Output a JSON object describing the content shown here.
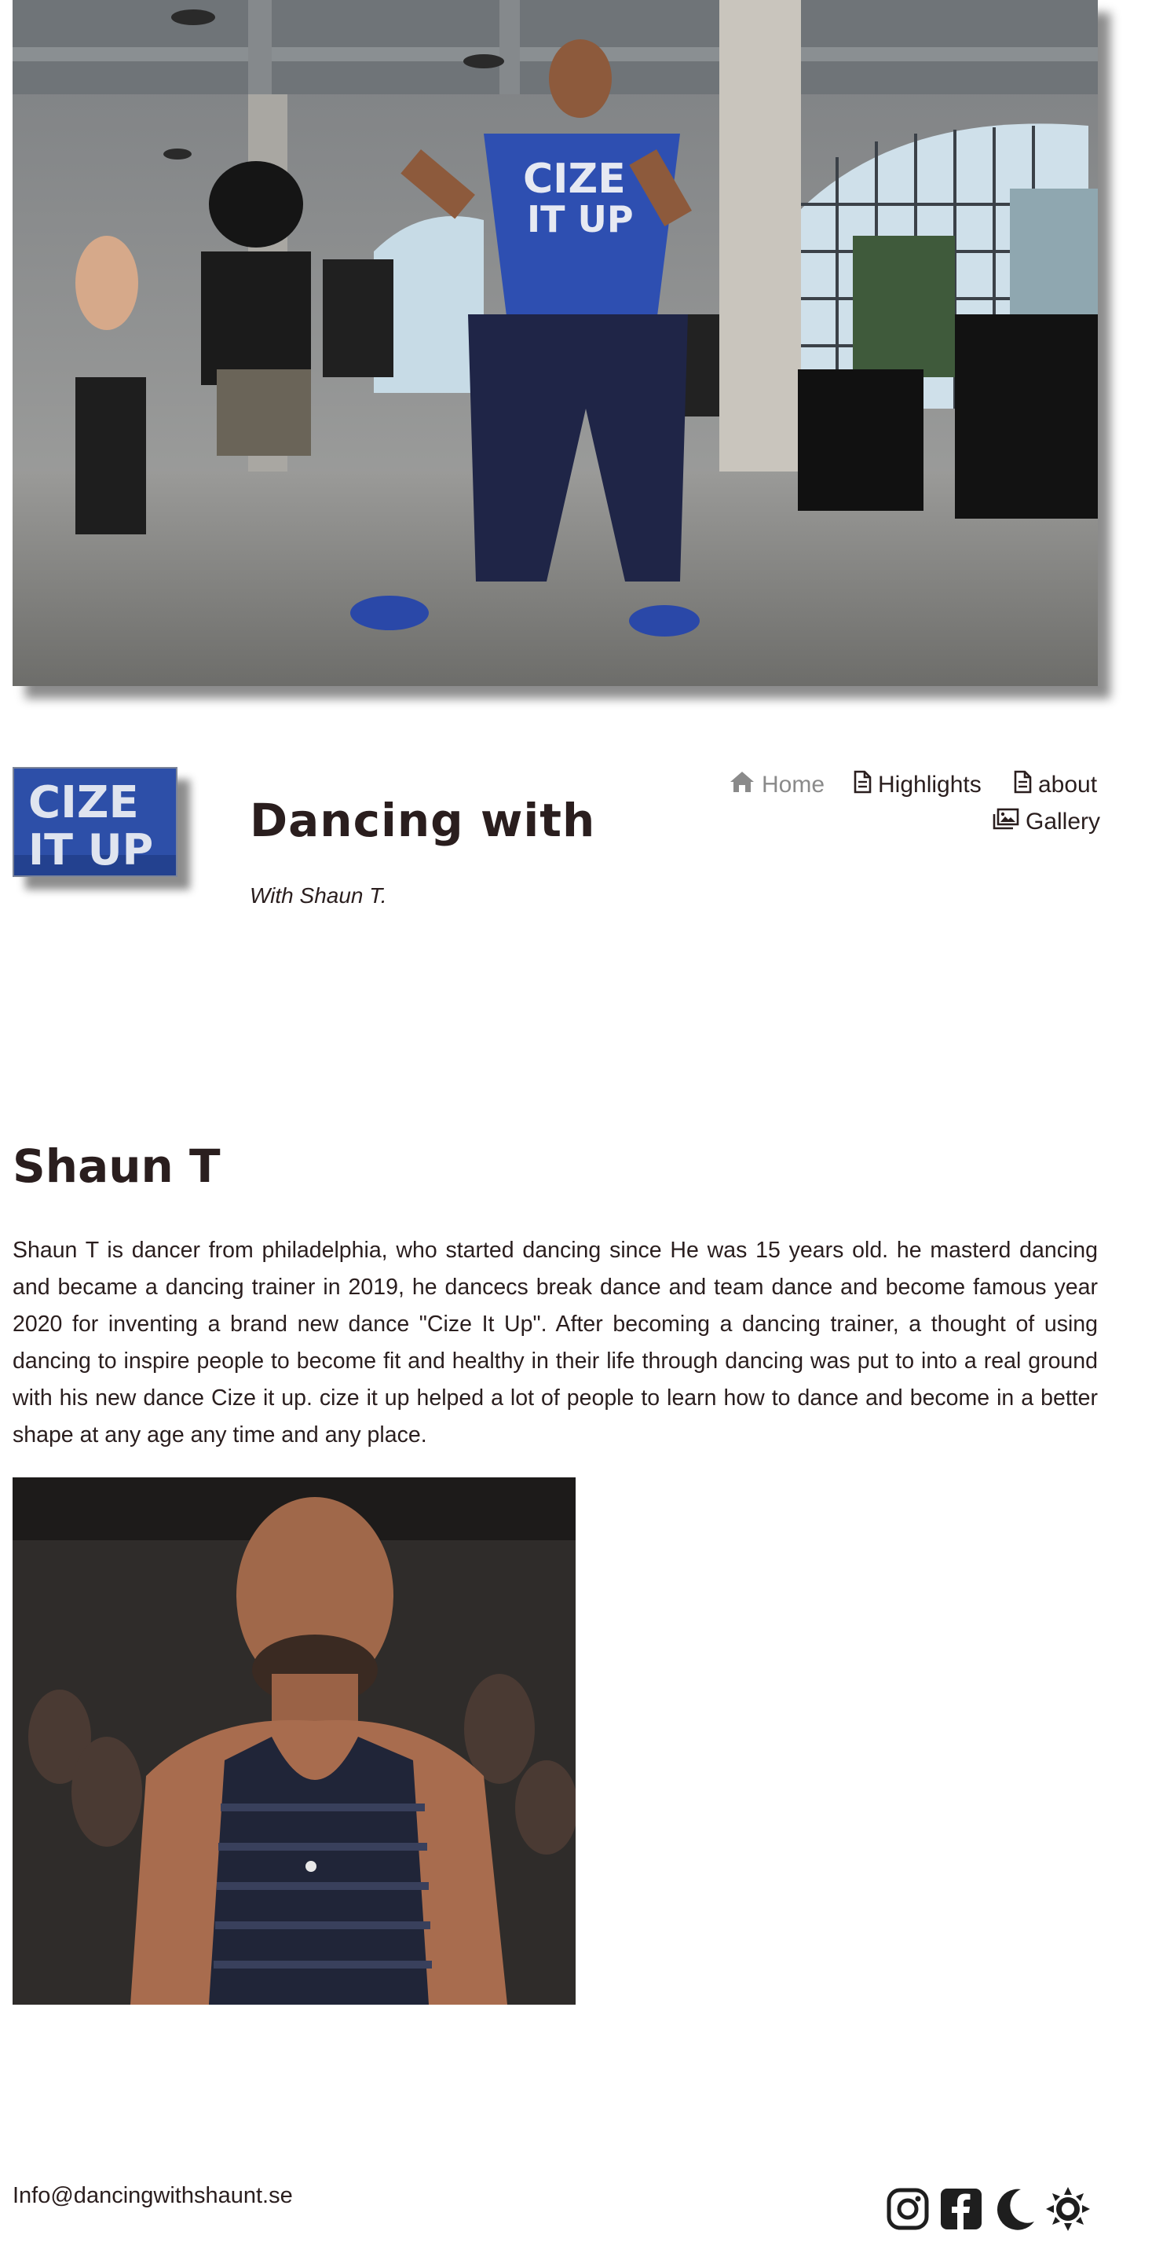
{
  "hero": {
    "icon": "dance-class-photo",
    "shirt_text_line1": "CIZE",
    "shirt_text_line2": "IT UP"
  },
  "header": {
    "logo": {
      "icon": "cize-it-up-logo",
      "text_line1": "CIZE",
      "text_line2": "IT UP"
    },
    "title": "Dancing with",
    "subtitle": "With Shaun T."
  },
  "nav": {
    "items": [
      {
        "label": "Home",
        "icon": "home-icon",
        "active": true
      },
      {
        "label": "Highlights",
        "icon": "document-icon"
      },
      {
        "label": "about",
        "icon": "document-icon"
      },
      {
        "label": "Gallery",
        "icon": "images-icon"
      }
    ]
  },
  "main": {
    "heading": "Shaun T",
    "bio": "Shaun T is dancer from philadelphia, who started dancing since He was 15 years old. he masterd dancing and became a dancing trainer in 2019, he dancecs break dance and team dance and become famous year 2020 for inventing a brand new dance \"Cize It Up\". After becoming a dancing trainer, a thought of using dancing to inspire people to become fit and healthy in their life through dancing was put to into a real ground with his new dance Cize it up. cize it up helped a lot of people to learn how to dance and become in a better shape at any age any time and any place.",
    "portrait": {
      "icon": "shaun-t-portrait-photo"
    }
  },
  "footer": {
    "email": "Info@dancingwithshaunt.se",
    "icons": [
      "instagram-icon",
      "facebook-icon",
      "dark-mode-moon-icon",
      "light-mode-sun-icon"
    ]
  },
  "colors": {
    "text": "#2a1e1e",
    "nav_active": "#8a8a8a",
    "logo_blue": "#2d4fa8"
  }
}
